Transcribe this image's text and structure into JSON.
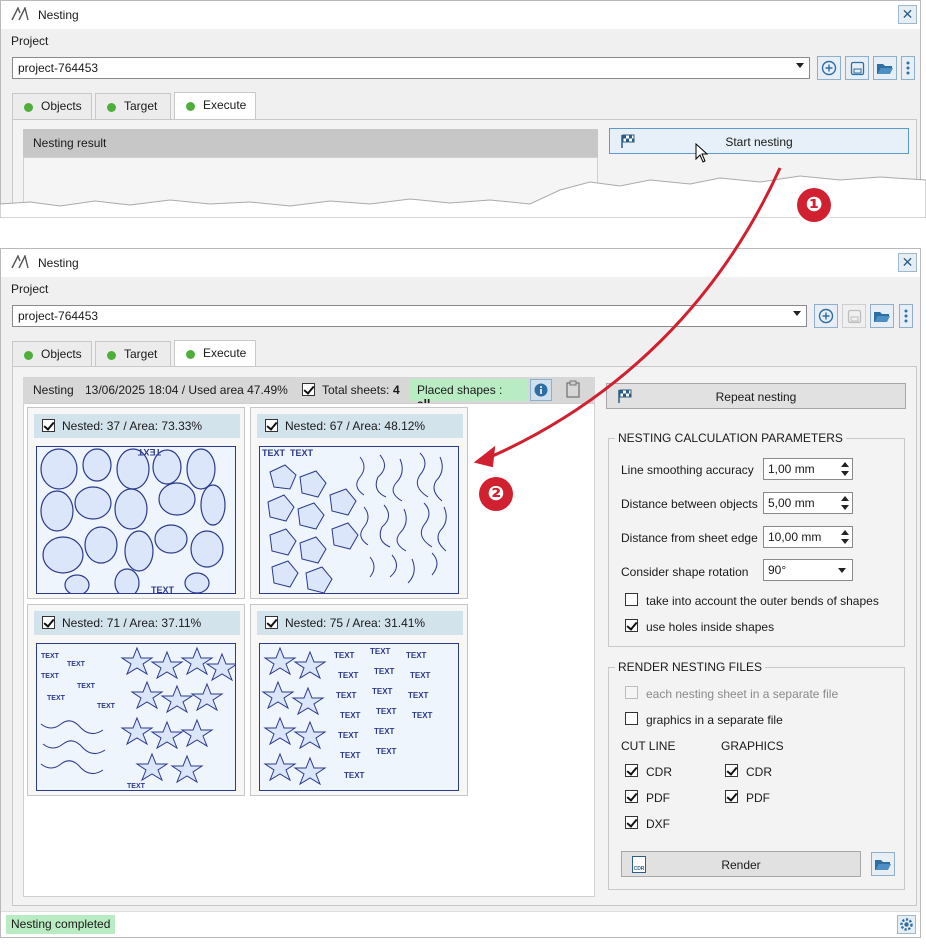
{
  "window": {
    "title": "Nesting"
  },
  "project": {
    "label": "Project",
    "value": "project-764453"
  },
  "tabs": [
    {
      "label": "Objects"
    },
    {
      "label": "Target"
    },
    {
      "label": "Execute"
    }
  ],
  "top": {
    "result_header": "Nesting result",
    "start_button": "Start nesting"
  },
  "markers": {
    "first": "❶",
    "second": "❷"
  },
  "summary": {
    "label": "Nesting",
    "datetime_area": "13/06/2025 18:04 / Used area 47.49%",
    "total_sheets_label": "Total sheets:",
    "total_sheets_value": "4",
    "placed_label": "Placed shapes :",
    "placed_value": "all"
  },
  "sheets": [
    {
      "label": "Nested: 37 / Area: 73.33%",
      "checked": true
    },
    {
      "label": "Nested: 67 / Area: 48.12%",
      "checked": true
    },
    {
      "label": "Nested: 71 / Area: 37.11%",
      "checked": true
    },
    {
      "label": "Nested: 75 / Area: 31.41%",
      "checked": true
    }
  ],
  "sheet_art_text": "TEXT",
  "repeat_button": "Repeat nesting",
  "params": {
    "title": "NESTING CALCULATION PARAMETERS",
    "smoothing": {
      "label": "Line smoothing accuracy",
      "value": "1,00 mm"
    },
    "distance_objects": {
      "label": "Distance between objects",
      "value": "5,00 mm"
    },
    "distance_edge": {
      "label": "Distance from sheet edge",
      "value": "10,00 mm"
    },
    "rotation": {
      "label": "Consider shape rotation",
      "value": "90°"
    },
    "outer_bends": {
      "label": "take into account the outer bends of shapes",
      "checked": false
    },
    "holes": {
      "label": "use holes inside shapes",
      "checked": true
    }
  },
  "render": {
    "title": "RENDER NESTING FILES",
    "separate_sheet": {
      "label": "each nesting sheet in a separate file",
      "checked": false,
      "disabled": true
    },
    "separate_graphics": {
      "label": "graphics in a separate file",
      "checked": false
    },
    "cut_line": {
      "title": "CUT LINE",
      "cdr": "CDR",
      "pdf": "PDF",
      "dxf": "DXF"
    },
    "graphics": {
      "title": "GRAPHICS",
      "cdr": "CDR",
      "pdf": "PDF"
    },
    "render_button": "Render",
    "cdr_icon_text": "CDR"
  },
  "status": {
    "text": "Nesting completed"
  },
  "colors": {
    "accent": "#d1202f",
    "status_ok": "#b9ecc2",
    "shape_outline": "#2b3a8c"
  }
}
